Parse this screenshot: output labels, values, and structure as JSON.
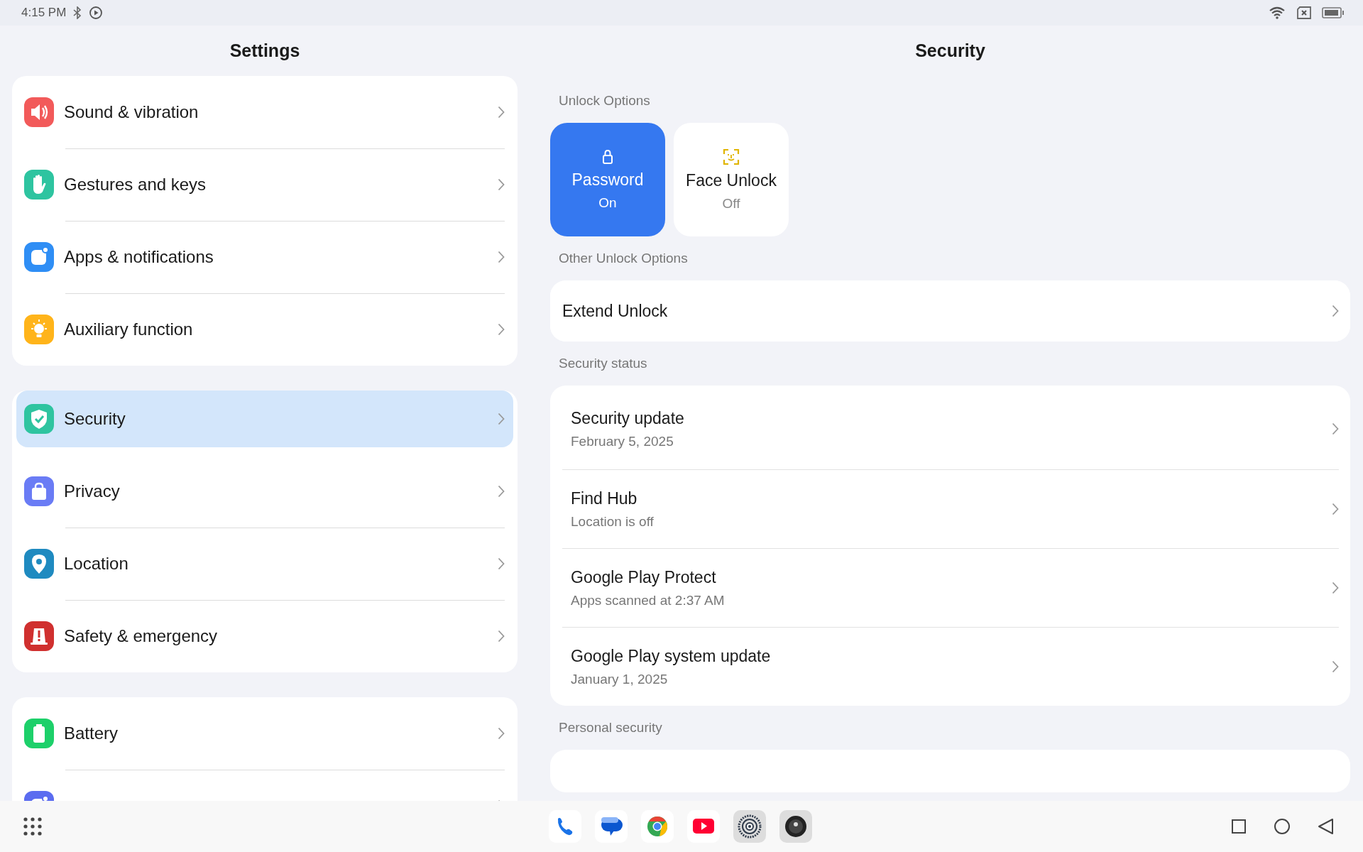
{
  "status_bar": {
    "time": "4:15 PM"
  },
  "settings": {
    "title": "Settings",
    "groups": [
      [
        {
          "kind": "sound",
          "label": "Sound & vibration",
          "color": "#f25a5a",
          "selected": false
        },
        {
          "kind": "hand",
          "label": "Gestures and keys",
          "color": "#2ec4a0",
          "selected": false
        },
        {
          "kind": "app",
          "label": "Apps & notifications",
          "color": "#2f8ef5",
          "selected": false
        },
        {
          "kind": "bulb",
          "label": "Auxiliary function",
          "color": "#ffb41a",
          "selected": false
        }
      ],
      [
        {
          "kind": "shield",
          "label": "Security",
          "color": "#2ec4a0",
          "selected": true
        },
        {
          "kind": "bag",
          "label": "Privacy",
          "color": "#6a7cf5",
          "selected": false
        },
        {
          "kind": "pin",
          "label": "Location",
          "color": "#1f8ac0",
          "selected": false
        },
        {
          "kind": "alert",
          "label": "Safety & emergency",
          "color": "#d0302f",
          "selected": false
        }
      ],
      [
        {
          "kind": "battery",
          "label": "Battery",
          "color": "#1dd06a",
          "selected": false
        },
        {
          "kind": "app",
          "color": "#5b6cf0",
          "selected": false
        }
      ]
    ]
  },
  "detail": {
    "title": "Security",
    "unlock": {
      "heading": "Unlock Options",
      "options": [
        {
          "kind": "lock",
          "label": "Password",
          "status": "On",
          "selected": true
        },
        {
          "kind": "face",
          "label": "Face Unlock",
          "status": "Off",
          "selected": false
        }
      ]
    },
    "other": {
      "heading": "Other Unlock Options",
      "items": [
        {
          "title": "Extend Unlock"
        }
      ]
    },
    "status": {
      "heading": "Security status",
      "items": [
        {
          "title": "Security update",
          "subtitle": "February 5, 2025"
        },
        {
          "title": "Find Hub",
          "subtitle": "Location is off"
        },
        {
          "title": "Google Play Protect",
          "subtitle": "Apps scanned at 2:37 AM"
        },
        {
          "title": "Google Play system update",
          "subtitle": "January 1, 2025"
        }
      ]
    },
    "personal": {
      "heading": "Personal security"
    }
  },
  "dock": {
    "apps": [
      {
        "kind": "phone"
      },
      {
        "kind": "messages"
      },
      {
        "kind": "browser"
      },
      {
        "kind": "video"
      },
      {
        "kind": "settings"
      },
      {
        "kind": "camera"
      }
    ]
  }
}
